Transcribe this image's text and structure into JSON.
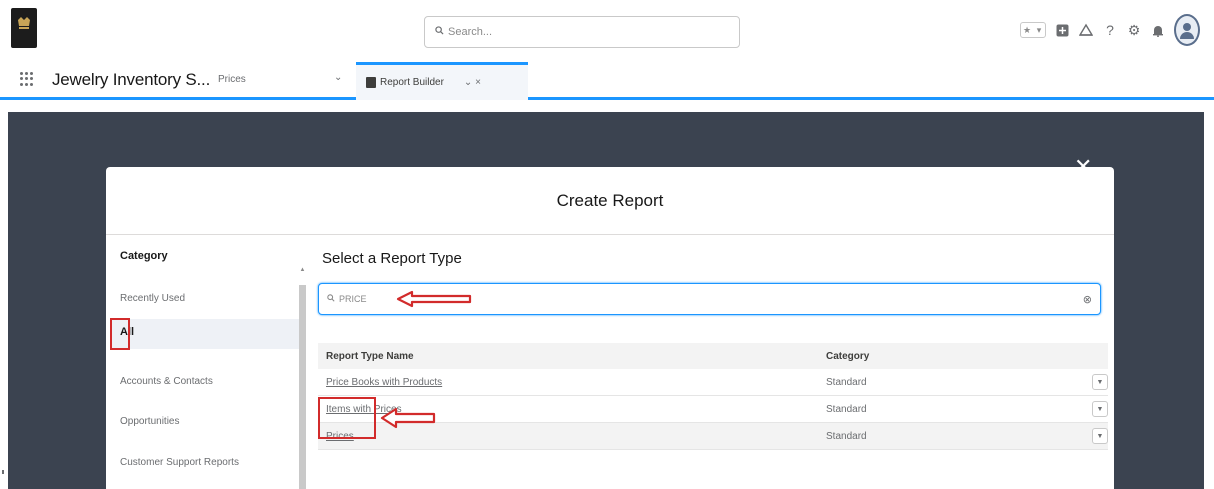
{
  "header": {
    "search_placeholder": "Search..."
  },
  "nav": {
    "app_name": "Jewelry Inventory S...",
    "nav_item": "Prices",
    "active_tab": "Report Builder"
  },
  "modal": {
    "title": "Create Report",
    "category_heading": "Category",
    "categories": [
      "Recently Used",
      "All",
      "Accounts & Contacts",
      "Opportunities",
      "Customer Support Reports"
    ],
    "selected_category": "All",
    "report_type_heading": "Select a Report Type",
    "search_value": "PRICE",
    "table": {
      "columns": [
        "Report Type Name",
        "Category"
      ],
      "rows": [
        {
          "name": "Price Books with Products",
          "category": "Standard"
        },
        {
          "name": "Items with Prices",
          "category": "Standard"
        },
        {
          "name": "Prices",
          "category": "Standard"
        }
      ]
    }
  },
  "colors": {
    "accent": "#1b96ff",
    "highlight_red": "#d22b2b",
    "backdrop": "#3b4350"
  },
  "icons": [
    "search-icon",
    "app-launcher-icon",
    "report-tab-icon",
    "close-icon",
    "help-icon",
    "gear-icon",
    "bell-icon",
    "clear-icon"
  ]
}
